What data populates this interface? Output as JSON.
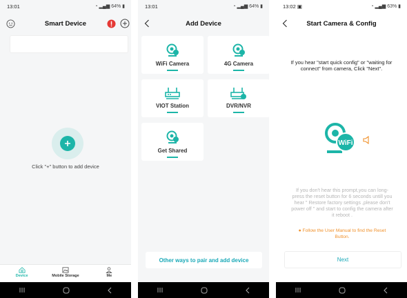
{
  "screens": {
    "smart_device": {
      "status_time": "13:01",
      "status_right": "64%",
      "title": "Smart Device",
      "empty_hint": "Click \"+\" button to add device",
      "tabs": [
        {
          "label": "Device"
        },
        {
          "label": "Mobile Storage"
        },
        {
          "label": "Me"
        }
      ]
    },
    "add_device": {
      "status_time": "13:01",
      "status_right": "64%",
      "title": "Add Device",
      "cards": [
        {
          "label": "WiFi Camera"
        },
        {
          "label": "4G Camera"
        },
        {
          "label": "VIOT Station"
        },
        {
          "label": "DVR/NVR"
        },
        {
          "label": "Get Shared"
        }
      ],
      "other_ways": "Other ways to pair and add device"
    },
    "start_camera": {
      "status_time": "13:02",
      "status_right": "63%",
      "title": "Start Camera & Config",
      "instruction": "If you hear \"start quick config\" or \"waiting for connect\" from camera, Click \"Next\".",
      "wifi_badge": "WiFi",
      "reset_help": "If you don't hear this prompt,you can long-press the reset button for 6 seconds untill you hear \" Restore factory settings ,please don't power off \" and start to config the camera after it reboot .",
      "manual_note": "● Follow the User Manual to find the Reset Button.",
      "next_label": "Next"
    }
  },
  "colors": {
    "accent": "#1cb5a8",
    "link": "#1aa9b8",
    "warning": "#e53935",
    "orange": "#f0902a"
  }
}
